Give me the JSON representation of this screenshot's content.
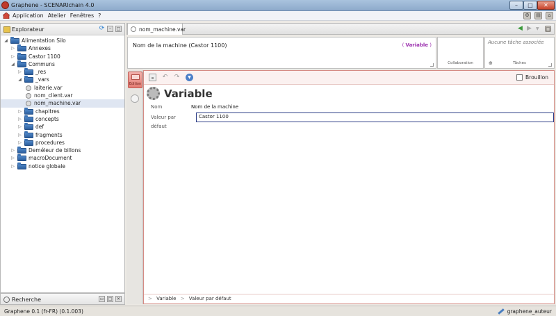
{
  "window": {
    "title": "Graphene - SCENARIchain 4.0",
    "controls": {
      "minimize": "–",
      "maximize": "□",
      "close": "✕"
    }
  },
  "menubar": {
    "items": [
      "Application",
      "Atelier",
      "Fenêtres",
      "?"
    ]
  },
  "explorer": {
    "title": "Explorateur",
    "tree": [
      {
        "label": "Alimentation Silo",
        "level": 0,
        "type": "folder",
        "expanded": true
      },
      {
        "label": "Annexes",
        "level": 1,
        "type": "folder",
        "expanded": false
      },
      {
        "label": "Castor 1100",
        "level": 1,
        "type": "folder",
        "expanded": false
      },
      {
        "label": "Communs",
        "level": 1,
        "type": "folder",
        "expanded": true
      },
      {
        "label": "_res",
        "level": 2,
        "type": "folder",
        "expanded": false
      },
      {
        "label": "_vars",
        "level": 2,
        "type": "folder",
        "expanded": true
      },
      {
        "label": "laiterie.var",
        "level": 3,
        "type": "file"
      },
      {
        "label": "nom_client.var",
        "level": 3,
        "type": "file"
      },
      {
        "label": "nom_machine.var",
        "level": 3,
        "type": "file",
        "selected": true
      },
      {
        "label": "chapitres",
        "level": 2,
        "type": "folder",
        "expanded": false
      },
      {
        "label": "concepts",
        "level": 2,
        "type": "folder",
        "expanded": false
      },
      {
        "label": "def",
        "level": 2,
        "type": "folder",
        "expanded": false
      },
      {
        "label": "fragments",
        "level": 2,
        "type": "folder",
        "expanded": false
      },
      {
        "label": "procedures",
        "level": 2,
        "type": "folder",
        "expanded": false
      },
      {
        "label": "Deméleur de billons",
        "level": 1,
        "type": "folder",
        "expanded": false
      },
      {
        "label": "macroDocument",
        "level": 1,
        "type": "folder",
        "expanded": false
      },
      {
        "label": "notice globale",
        "level": 1,
        "type": "folder",
        "expanded": false
      }
    ]
  },
  "search": {
    "label": "Recherche"
  },
  "statusbar": {
    "version": "Graphene 0.1 (fr-FR) (0.1.003)",
    "user": "graphene_auteur"
  },
  "editor": {
    "tab_label": "nom_machine.var",
    "item_title": "Nom de la machine (Castor 1100)",
    "item_type": "Variable",
    "collaboration_label": "Collaboration",
    "tasks_empty": "Aucune tâche associée",
    "tasks_label": "Tâches",
    "edit_mode_label": "Edition",
    "draft_label": "Brouillon",
    "heading": "Variable",
    "fields": {
      "name_label": "Nom",
      "name_value": "Nom de la machine",
      "default_label": "Valeur par défaut",
      "default_value": "Castor 1100"
    },
    "path": [
      "Variable",
      "Valeur par défaut"
    ]
  },
  "colors": {
    "accent_red": "#e47d74",
    "input_border": "#2a3b85",
    "badge": "#9b2fae"
  }
}
